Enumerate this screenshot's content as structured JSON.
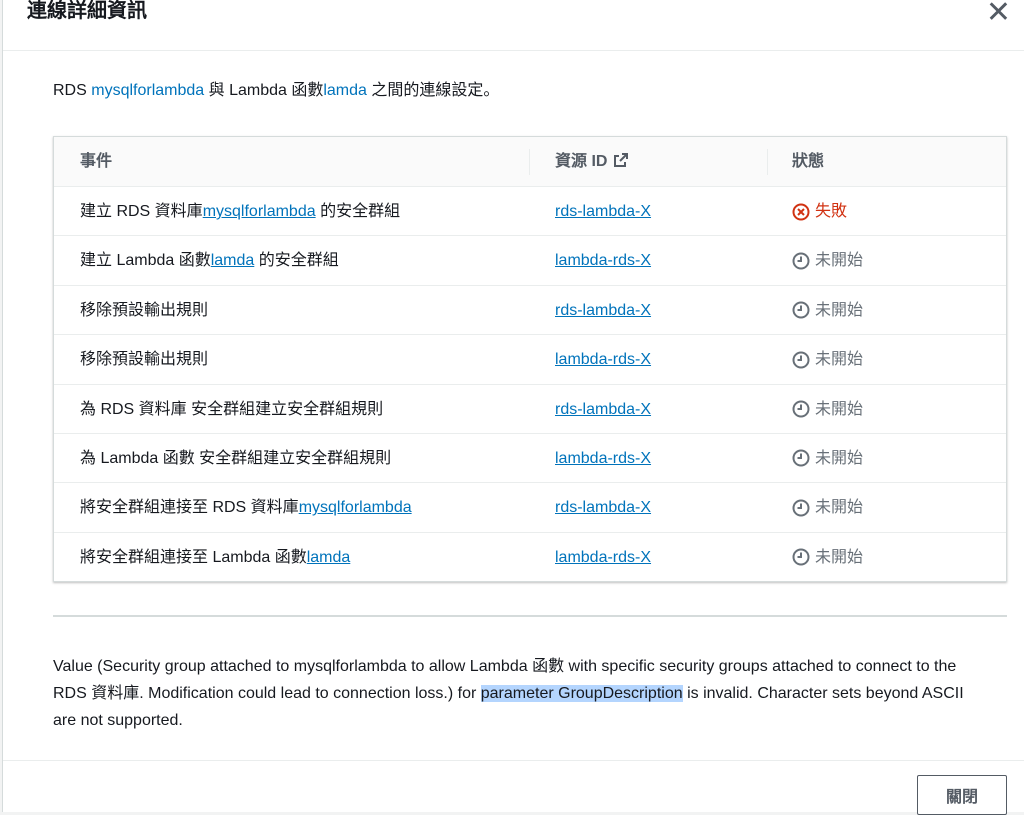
{
  "header": {
    "title": "連線詳細資訊"
  },
  "intro": {
    "t1": "RDS ",
    "db_name": "mysqlforlambda",
    "t2": " 與 Lambda 函數",
    "fn_name": "lamda",
    "t3": " 之間的連線設定。"
  },
  "table": {
    "headers": {
      "event": "事件",
      "resource": "資源 ID",
      "status": "狀態"
    },
    "rows": [
      {
        "event_pre": "建立 RDS 資料庫",
        "event_link": "mysqlforlambda",
        "event_post": " 的安全群組",
        "resource": "rds-lambda-X",
        "status": "失敗",
        "state": "failed"
      },
      {
        "event_pre": "建立 Lambda 函數",
        "event_link": "lamda",
        "event_post": " 的安全群組",
        "resource": "lambda-rds-X",
        "status": "未開始",
        "state": "pending"
      },
      {
        "event_pre": "移除預設輸出規則",
        "event_link": "",
        "event_post": "",
        "resource": "rds-lambda-X",
        "status": "未開始",
        "state": "pending"
      },
      {
        "event_pre": "移除預設輸出規則",
        "event_link": "",
        "event_post": "",
        "resource": "lambda-rds-X",
        "status": "未開始",
        "state": "pending"
      },
      {
        "event_pre": "為 RDS 資料庫 安全群組建立安全群組規則",
        "event_link": "",
        "event_post": "",
        "resource": "rds-lambda-X",
        "status": "未開始",
        "state": "pending"
      },
      {
        "event_pre": "為 Lambda 函數 安全群組建立安全群組規則",
        "event_link": "",
        "event_post": "",
        "resource": "lambda-rds-X",
        "status": "未開始",
        "state": "pending"
      },
      {
        "event_pre": "將安全群組連接至 RDS 資料庫",
        "event_link": "mysqlforlambda",
        "event_post": "",
        "resource": "rds-lambda-X",
        "status": "未開始",
        "state": "pending"
      },
      {
        "event_pre": "將安全群組連接至 Lambda 函數",
        "event_link": "lamda",
        "event_post": "",
        "resource": "lambda-rds-X",
        "status": "未開始",
        "state": "pending"
      }
    ]
  },
  "error": {
    "before": "Value (Security group attached to mysqlforlambda to allow Lambda 函數 with specific security groups attached to connect to the RDS 資料庫. Modification could lead to connection loss.) for ",
    "highlight": "parameter GroupDescription",
    "after": " is invalid. Character sets beyond ASCII are not supported."
  },
  "footer": {
    "close_label": "關閉"
  },
  "colors": {
    "link": "#0073bb",
    "failed": "#d13212",
    "pending": "#687078",
    "highlight": "#b4d5fe"
  }
}
